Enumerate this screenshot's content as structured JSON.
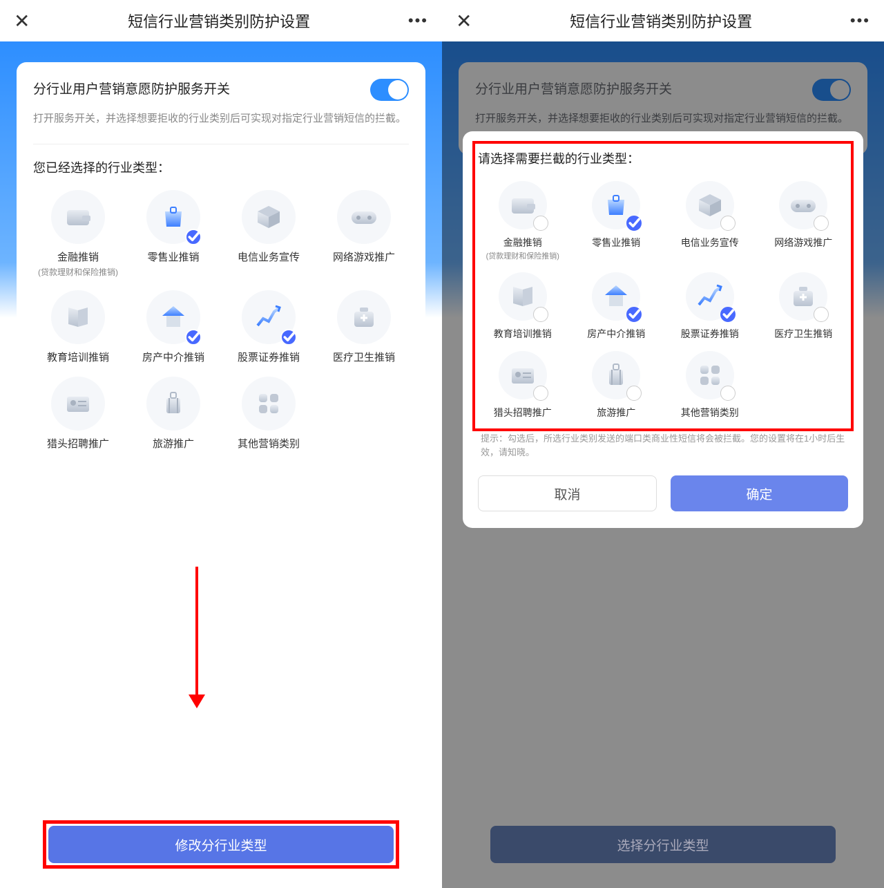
{
  "titlebar": {
    "title": "短信行业营销类别防护设置"
  },
  "card": {
    "switch_title": "分行业用户营销意愿防护服务开关",
    "switch_desc": "打开服务开关，并选择想要拒收的行业类别后可实现对指定行业营销短信的拦截。",
    "selected_title": "您已经选择的行业类型：",
    "button_modify": "修改分行业类型",
    "button_select": "选择分行业类型"
  },
  "modal": {
    "title": "请选择需要拦截的行业类型：",
    "hint": "提示：勾选后，所选行业类别发送的端口类商业性短信将会被拦截。您的设置将在1小时后生效，请知晓。",
    "cancel": "取消",
    "confirm": "确定"
  },
  "categories": [
    {
      "label": "金融推销",
      "sub": "(贷款理财和保险推销)",
      "icon": "wallet",
      "checked_left": false,
      "checked_right": false
    },
    {
      "label": "零售业推销",
      "sub": "",
      "icon": "bag",
      "checked_left": true,
      "checked_right": true
    },
    {
      "label": "电信业务宣传",
      "sub": "",
      "icon": "cube",
      "checked_left": false,
      "checked_right": false
    },
    {
      "label": "网络游戏推广",
      "sub": "",
      "icon": "gamepad",
      "checked_left": false,
      "checked_right": false
    },
    {
      "label": "教育培训推销",
      "sub": "",
      "icon": "book",
      "checked_left": false,
      "checked_right": false
    },
    {
      "label": "房产中介推销",
      "sub": "",
      "icon": "house",
      "checked_left": true,
      "checked_right": true
    },
    {
      "label": "股票证券推销",
      "sub": "",
      "icon": "chart",
      "checked_left": true,
      "checked_right": true
    },
    {
      "label": "医疗卫生推销",
      "sub": "",
      "icon": "medkit",
      "checked_left": false,
      "checked_right": false
    },
    {
      "label": "猎头招聘推广",
      "sub": "",
      "icon": "idcard",
      "checked_left": false,
      "checked_right": false
    },
    {
      "label": "旅游推广",
      "sub": "",
      "icon": "luggage",
      "checked_left": false,
      "checked_right": false
    },
    {
      "label": "其他营销类别",
      "sub": "",
      "icon": "grid",
      "checked_left": false,
      "checked_right": false
    }
  ]
}
